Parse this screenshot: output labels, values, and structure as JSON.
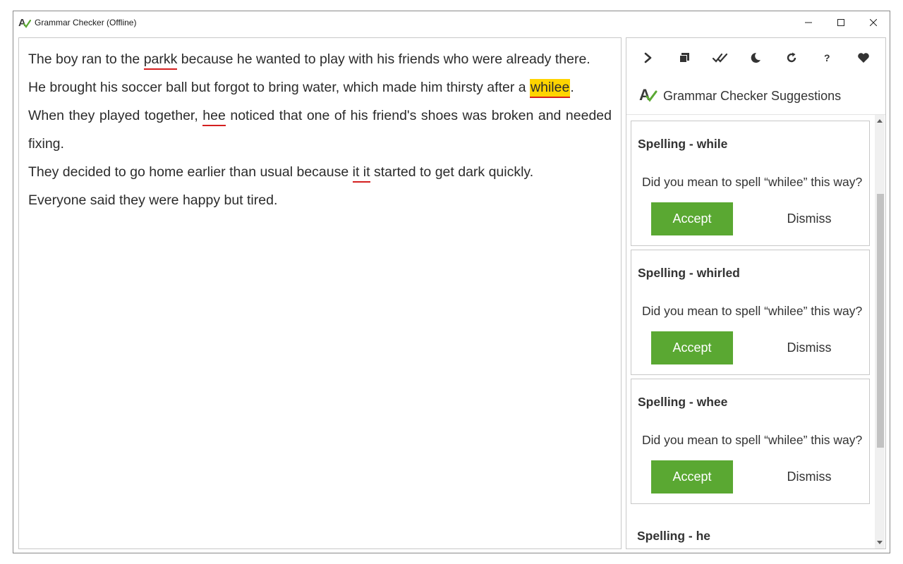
{
  "window": {
    "title": "Grammar Checker (Offline)",
    "icon": "app-logo-icon",
    "controls": [
      "minimize-icon",
      "maximize-icon",
      "close-icon"
    ]
  },
  "editor": {
    "lines": [
      {
        "segments": [
          {
            "text": "The boy ran to the "
          },
          {
            "text": "parkk",
            "style": "error"
          },
          {
            "text": " because he wanted to play with his friends who were already there."
          }
        ]
      },
      {
        "segments": [
          {
            "text": "He brought his soccer ball but forgot to bring water, which made him thirsty after a "
          },
          {
            "text": "whilee",
            "style": "highlight"
          },
          {
            "text": "."
          }
        ]
      },
      {
        "segments": [
          {
            "text": "When they played together, "
          },
          {
            "text": "hee",
            "style": "error"
          },
          {
            "text": " noticed that one of his friend's shoes was broken and needed fixing."
          }
        ]
      },
      {
        "segments": [
          {
            "text": "They decided to go home earlier than usual because "
          },
          {
            "text": "it it",
            "style": "error"
          },
          {
            "text": " started to get dark quickly."
          }
        ]
      },
      {
        "segments": [
          {
            "text": "Everyone said they were happy but tired."
          }
        ]
      }
    ]
  },
  "panel": {
    "toolbar": [
      {
        "name": "collapse-panel",
        "icon": "chevron-right-icon"
      },
      {
        "name": "copy",
        "icon": "copy-icon"
      },
      {
        "name": "accept-all",
        "icon": "double-check-icon"
      },
      {
        "name": "dark-mode",
        "icon": "moon-icon"
      },
      {
        "name": "refresh",
        "icon": "refresh-icon"
      },
      {
        "name": "help",
        "icon": "question-icon"
      },
      {
        "name": "favorite",
        "icon": "heart-icon"
      }
    ],
    "header_title": "Grammar Checker Suggestions",
    "cards": [
      {
        "title": "Spelling - while",
        "question": "Did you mean to spell “whilee” this way?",
        "accept": "Accept",
        "dismiss": "Dismiss"
      },
      {
        "title": "Spelling - whirled",
        "question": "Did you mean to spell “whilee” this way?",
        "accept": "Accept",
        "dismiss": "Dismiss"
      },
      {
        "title": "Spelling - whee",
        "question": "Did you mean to spell “whilee” this way?",
        "accept": "Accept",
        "dismiss": "Dismiss"
      }
    ],
    "partial_card_title": "Spelling - he"
  },
  "colors": {
    "accept_button": "#5aa832",
    "highlight": "#ffd400",
    "error_underline": "#d42020"
  }
}
